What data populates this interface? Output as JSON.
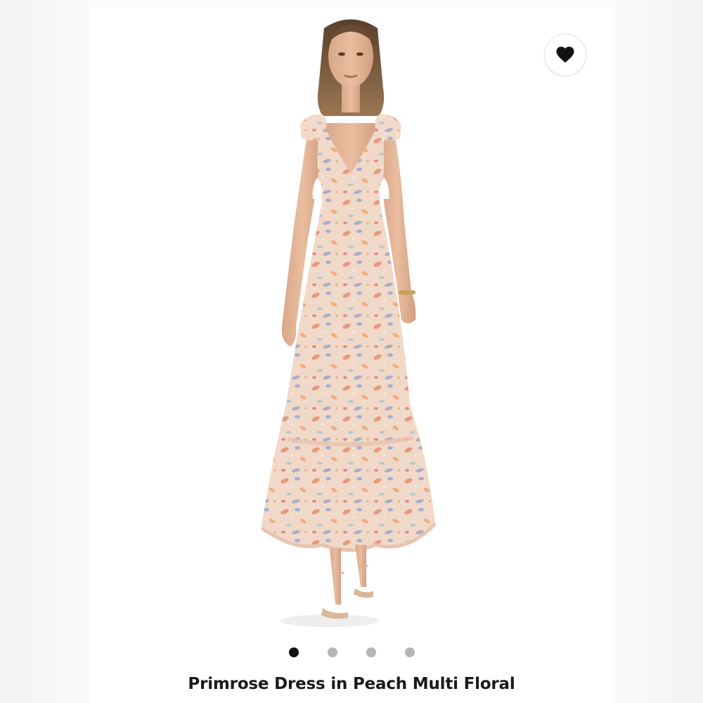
{
  "product": {
    "title": "Primrose Dress in Peach Multi Floral"
  },
  "favorite": {
    "icon": "heart-icon",
    "active": true,
    "color": "#111111"
  },
  "carousel": {
    "total": 4,
    "current": 1
  },
  "colors": {
    "background": "#f6f6f6",
    "card": "#ffffff",
    "dot_inactive": "#b5b5b5",
    "dot_active": "#111111"
  }
}
